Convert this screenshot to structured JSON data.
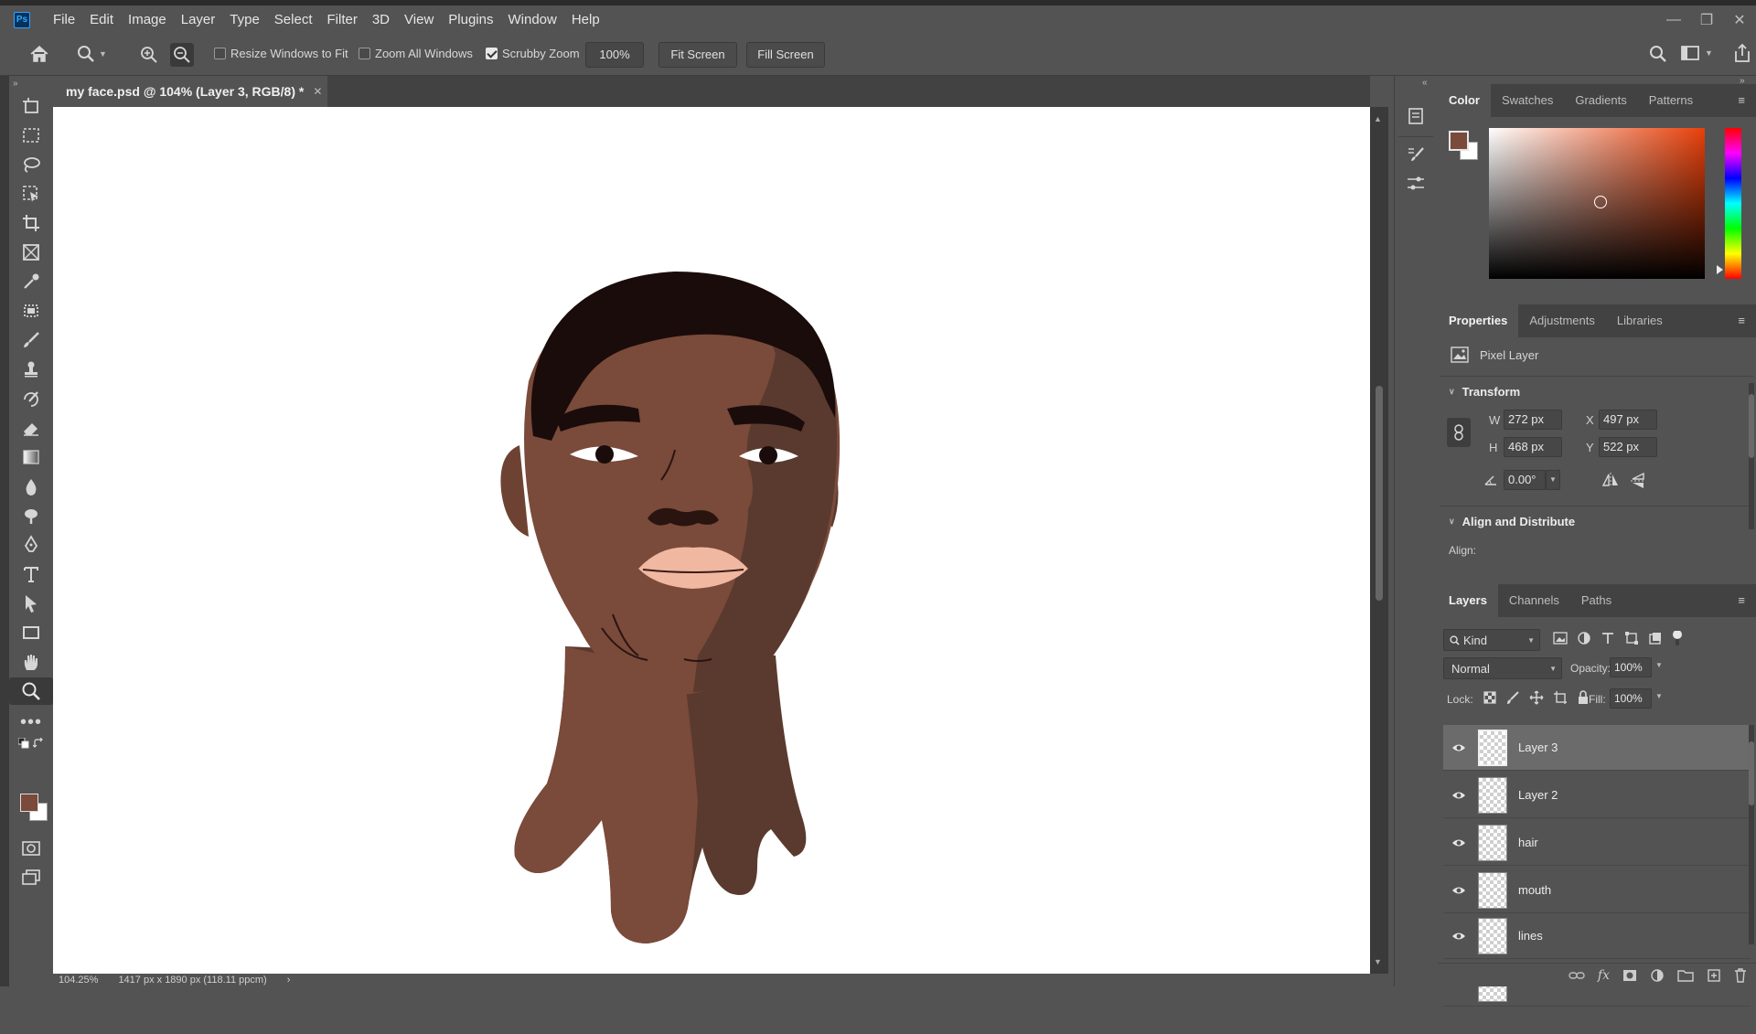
{
  "app": {
    "logo_text": "Ps"
  },
  "menu": [
    "File",
    "Edit",
    "Image",
    "Layer",
    "Type",
    "Select",
    "Filter",
    "3D",
    "View",
    "Plugins",
    "Window",
    "Help"
  ],
  "options": {
    "resize_windows": {
      "label": "Resize Windows to Fit",
      "checked": false
    },
    "zoom_all": {
      "label": "Zoom All Windows",
      "checked": false
    },
    "scrubby": {
      "label": "Scrubby Zoom",
      "checked": true
    },
    "zoom_value": "100%",
    "fit_screen": "Fit Screen",
    "fill_screen": "Fill Screen"
  },
  "document": {
    "tab_title": "my face.psd @ 104% (Layer 3, RGB/8) *"
  },
  "status": {
    "zoom": "104.25%",
    "size": "1417 px x 1890 px (118.11 ppcm)"
  },
  "color_panel": {
    "tabs": [
      "Color",
      "Swatches",
      "Gradients",
      "Patterns"
    ],
    "foreground": "#7a4a3a",
    "background": "#ffffff"
  },
  "properties": {
    "tabs": [
      "Properties",
      "Adjustments",
      "Libraries"
    ],
    "layer_type": "Pixel Layer",
    "transform_title": "Transform",
    "w_label": "W",
    "w": "272 px",
    "h_label": "H",
    "h": "468 px",
    "x_label": "X",
    "x": "497 px",
    "y_label": "Y",
    "y": "522 px",
    "angle": "0.00°",
    "align_title": "Align and Distribute",
    "align_label": "Align:"
  },
  "layers_panel": {
    "tabs": [
      "Layers",
      "Channels",
      "Paths"
    ],
    "filter": "Kind",
    "blend_mode": "Normal",
    "opacity_label": "Opacity:",
    "opacity": "100%",
    "lock_label": "Lock:",
    "fill_label": "Fill:",
    "fill": "100%",
    "layers": [
      {
        "name": "Layer 3",
        "selected": true
      },
      {
        "name": "Layer 2",
        "selected": false
      },
      {
        "name": "hair",
        "selected": false
      },
      {
        "name": "mouth",
        "selected": false
      },
      {
        "name": "lines",
        "selected": false
      }
    ]
  }
}
